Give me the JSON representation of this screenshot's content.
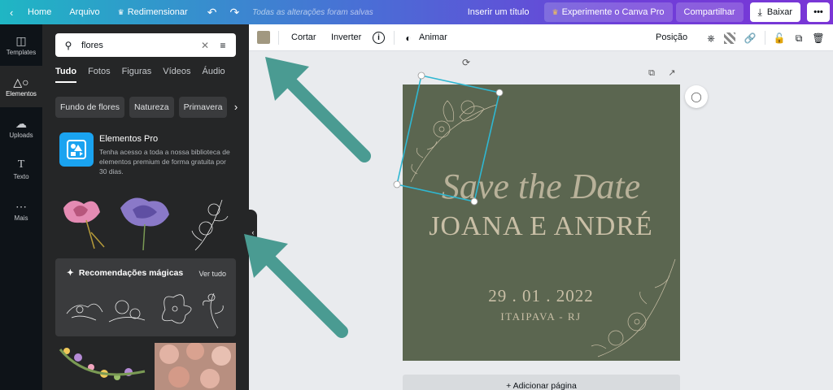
{
  "topbar": {
    "back_icon": "chevron-left-icon",
    "home": "Home",
    "file": "Arquivo",
    "resize": "Redimensionar",
    "saved": "Todas as alterações foram salvas",
    "title_placeholder": "Inserir um título",
    "pro": "Experimente o Canva Pro",
    "share": "Compartilhar",
    "download": "Baixar",
    "more": "•••"
  },
  "rail": {
    "items": [
      {
        "label": "Templates",
        "icon": "templates-icon"
      },
      {
        "label": "Elementos",
        "icon": "elements-icon"
      },
      {
        "label": "Uploads",
        "icon": "upload-icon"
      },
      {
        "label": "Texto",
        "icon": "text-icon"
      },
      {
        "label": "Mais",
        "icon": "more-icon"
      }
    ],
    "active_index": 1
  },
  "panel": {
    "search_value": "flores",
    "tabs": [
      "Tudo",
      "Fotos",
      "Figuras",
      "Vídeos",
      "Áudio"
    ],
    "active_tab": "Tudo",
    "chips": [
      "Fundo de flores",
      "Natureza",
      "Primavera"
    ],
    "pro_title": "Elementos Pro",
    "pro_desc": "Tenha acesso a toda a nossa biblioteca de elementos premium de forma gratuita por 30 dias.",
    "magic_title": "Recomendações mágicas",
    "magic_link": "Ver tudo"
  },
  "ctx": {
    "crop": "Cortar",
    "flip": "Inverter",
    "animate": "Animar",
    "position": "Posição",
    "swatch_color": "#a19880"
  },
  "design": {
    "script_title": "Save the Date",
    "names": "Joana e André",
    "date": "29 . 01 . 2022",
    "location": "Itaipava - RJ",
    "bg_color": "#5b6650",
    "text_color": "#c9bfa6"
  },
  "canvas": {
    "add_page": "+ Adicionar página"
  },
  "colors": {
    "arrow": "#4a9b92",
    "selection": "#2fb7d1"
  }
}
